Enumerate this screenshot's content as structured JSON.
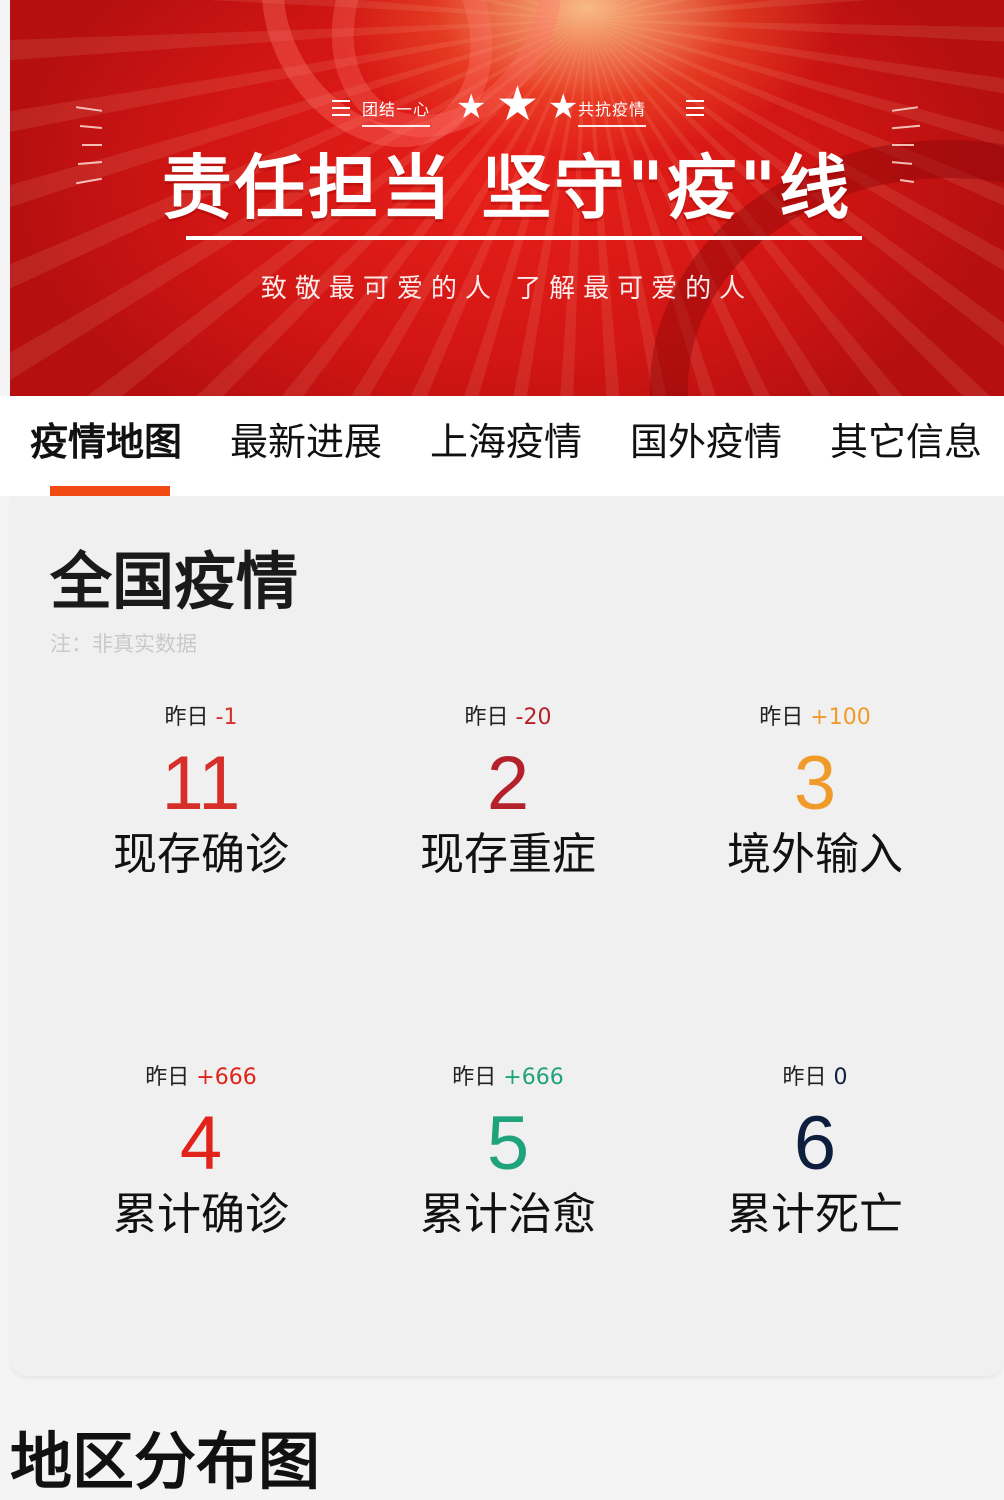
{
  "banner": {
    "motto_left": "团结一心",
    "motto_right": "共抗疫情",
    "stars": [
      "★",
      "★",
      "★"
    ],
    "title": "责任担当 坚守\"疫\"线",
    "subtitle": "致敬最可爱的人 了解最可爱的人"
  },
  "tabs": [
    {
      "label": "疫情地图",
      "active": true
    },
    {
      "label": "最新进展",
      "active": false
    },
    {
      "label": "上海疫情",
      "active": false
    },
    {
      "label": "国外疫情",
      "active": false
    },
    {
      "label": "其它信息",
      "active": false
    }
  ],
  "accent_color": "#f04a12",
  "national": {
    "title": "全国疫情",
    "note": "注：非真实数据",
    "yesterday_label": "昨日",
    "stats": [
      {
        "label": "现存确诊",
        "value": "11",
        "delta": "-1",
        "color": "#d62f2a"
      },
      {
        "label": "现存重症",
        "value": "2",
        "delta": "-20",
        "color": "#b5212b"
      },
      {
        "label": "境外输入",
        "value": "3",
        "delta": "+100",
        "color": "#f09a2a"
      },
      {
        "label": "累计确诊",
        "value": "4",
        "delta": "+666",
        "color": "#e2231a"
      },
      {
        "label": "累计治愈",
        "value": "5",
        "delta": "+666",
        "color": "#1fa37a"
      },
      {
        "label": "累计死亡",
        "value": "6",
        "delta": "0",
        "color": "#0e1e3d"
      }
    ]
  },
  "next_section": {
    "title": "地区分布图"
  }
}
